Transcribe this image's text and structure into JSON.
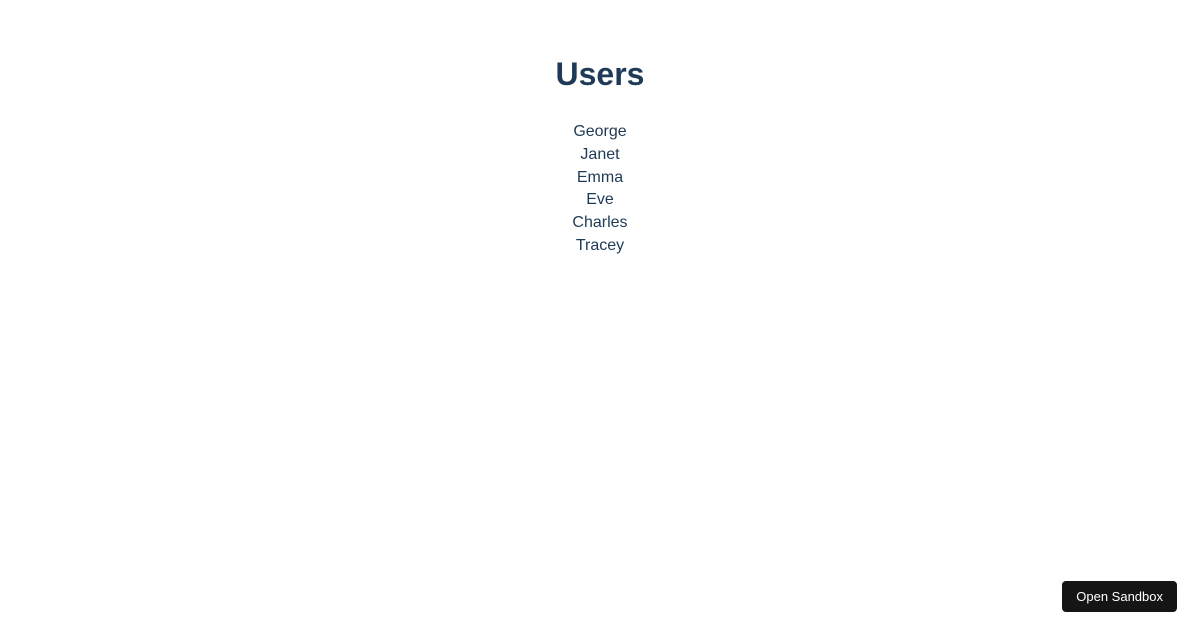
{
  "page": {
    "title": "Users"
  },
  "users": [
    "George",
    "Janet",
    "Emma",
    "Eve",
    "Charles",
    "Tracey"
  ],
  "sandbox": {
    "button_label": "Open Sandbox"
  }
}
